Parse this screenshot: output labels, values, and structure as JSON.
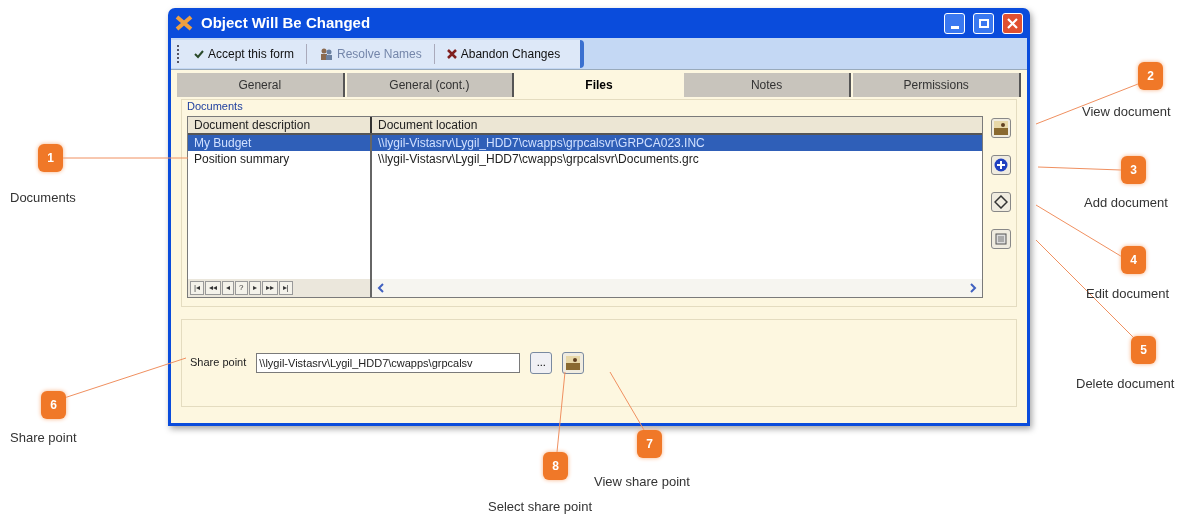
{
  "window": {
    "title": "Object Will Be Changed"
  },
  "toolbar": [
    {
      "kind": "accept",
      "label": "Accept this form",
      "disabled": false
    },
    {
      "kind": "resolve",
      "label": "Resolve Names",
      "disabled": true
    },
    {
      "kind": "abandon",
      "label": "Abandon Changes",
      "disabled": false
    }
  ],
  "tabs": [
    {
      "label": "General",
      "selected": false
    },
    {
      "label": "General (cont.)",
      "selected": false
    },
    {
      "label": "Files",
      "selected": true
    },
    {
      "label": "Notes",
      "selected": false
    },
    {
      "label": "Permissions",
      "selected": false
    }
  ],
  "documents": {
    "title": "Documents",
    "columns": [
      "Document description",
      "Document location"
    ],
    "rows": [
      {
        "description": "My Budget",
        "location": "\\\\lygil-Vistasrv\\Lygil_HDD7\\cwapps\\grpcalsvr\\GRPCA023.INC",
        "selected": true
      },
      {
        "description": "Position summary",
        "location": "\\\\lygil-Vistasrv\\Lygil_HDD7\\cwapps\\grpcalsvr\\Documents.grc",
        "selected": false
      }
    ],
    "nav_buttons": [
      "|◂",
      "◂◂",
      "◂",
      "?",
      "▸",
      "▸▸",
      "▸|"
    ]
  },
  "share_point": {
    "label": "Share point",
    "value": "\\\\lygil-Vistasrv\\Lygil_HDD7\\cwapps\\grpcalsv",
    "browse_button": "..."
  },
  "callouts": [
    {
      "number": "1",
      "label": "Documents"
    },
    {
      "number": "2",
      "label": "View document"
    },
    {
      "number": "3",
      "label": "Add document"
    },
    {
      "number": "4",
      "label": "Edit document"
    },
    {
      "number": "5",
      "label": "Delete document"
    },
    {
      "number": "6",
      "label": "Share point"
    },
    {
      "number": "7",
      "label": "View share point"
    },
    {
      "number": "8",
      "label": "Select share point"
    }
  ]
}
